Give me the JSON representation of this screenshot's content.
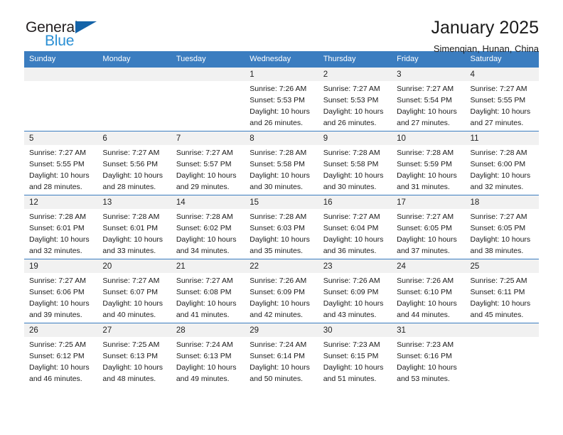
{
  "brand": {
    "word_top": "General",
    "word_bottom": "Blue",
    "triangle_color": "#1463a8",
    "blue_color": "#2a8fd4"
  },
  "header": {
    "title": "January 2025",
    "subtitle": "Simenqian, Hunan, China"
  },
  "colors": {
    "header_row": "#3b7dc0",
    "daynum_band": "#f1f1f1",
    "grid_line": "#3b7dc0"
  },
  "weekdays": [
    "Sunday",
    "Monday",
    "Tuesday",
    "Wednesday",
    "Thursday",
    "Friday",
    "Saturday"
  ],
  "labels": {
    "sunrise_prefix": "Sunrise: ",
    "sunset_prefix": "Sunset: ",
    "daylight_prefix": "Daylight: "
  },
  "weeks": [
    [
      {
        "day": "",
        "empty": true
      },
      {
        "day": "",
        "empty": true
      },
      {
        "day": "",
        "empty": true
      },
      {
        "day": "1",
        "sunrise": "Sunrise: 7:26 AM",
        "sunset": "Sunset: 5:53 PM",
        "daylight": "Daylight: 10 hours and 26 minutes."
      },
      {
        "day": "2",
        "sunrise": "Sunrise: 7:27 AM",
        "sunset": "Sunset: 5:53 PM",
        "daylight": "Daylight: 10 hours and 26 minutes."
      },
      {
        "day": "3",
        "sunrise": "Sunrise: 7:27 AM",
        "sunset": "Sunset: 5:54 PM",
        "daylight": "Daylight: 10 hours and 27 minutes."
      },
      {
        "day": "4",
        "sunrise": "Sunrise: 7:27 AM",
        "sunset": "Sunset: 5:55 PM",
        "daylight": "Daylight: 10 hours and 27 minutes."
      }
    ],
    [
      {
        "day": "5",
        "sunrise": "Sunrise: 7:27 AM",
        "sunset": "Sunset: 5:55 PM",
        "daylight": "Daylight: 10 hours and 28 minutes."
      },
      {
        "day": "6",
        "sunrise": "Sunrise: 7:27 AM",
        "sunset": "Sunset: 5:56 PM",
        "daylight": "Daylight: 10 hours and 28 minutes."
      },
      {
        "day": "7",
        "sunrise": "Sunrise: 7:27 AM",
        "sunset": "Sunset: 5:57 PM",
        "daylight": "Daylight: 10 hours and 29 minutes."
      },
      {
        "day": "8",
        "sunrise": "Sunrise: 7:28 AM",
        "sunset": "Sunset: 5:58 PM",
        "daylight": "Daylight: 10 hours and 30 minutes."
      },
      {
        "day": "9",
        "sunrise": "Sunrise: 7:28 AM",
        "sunset": "Sunset: 5:58 PM",
        "daylight": "Daylight: 10 hours and 30 minutes."
      },
      {
        "day": "10",
        "sunrise": "Sunrise: 7:28 AM",
        "sunset": "Sunset: 5:59 PM",
        "daylight": "Daylight: 10 hours and 31 minutes."
      },
      {
        "day": "11",
        "sunrise": "Sunrise: 7:28 AM",
        "sunset": "Sunset: 6:00 PM",
        "daylight": "Daylight: 10 hours and 32 minutes."
      }
    ],
    [
      {
        "day": "12",
        "sunrise": "Sunrise: 7:28 AM",
        "sunset": "Sunset: 6:01 PM",
        "daylight": "Daylight: 10 hours and 32 minutes."
      },
      {
        "day": "13",
        "sunrise": "Sunrise: 7:28 AM",
        "sunset": "Sunset: 6:01 PM",
        "daylight": "Daylight: 10 hours and 33 minutes."
      },
      {
        "day": "14",
        "sunrise": "Sunrise: 7:28 AM",
        "sunset": "Sunset: 6:02 PM",
        "daylight": "Daylight: 10 hours and 34 minutes."
      },
      {
        "day": "15",
        "sunrise": "Sunrise: 7:28 AM",
        "sunset": "Sunset: 6:03 PM",
        "daylight": "Daylight: 10 hours and 35 minutes."
      },
      {
        "day": "16",
        "sunrise": "Sunrise: 7:27 AM",
        "sunset": "Sunset: 6:04 PM",
        "daylight": "Daylight: 10 hours and 36 minutes."
      },
      {
        "day": "17",
        "sunrise": "Sunrise: 7:27 AM",
        "sunset": "Sunset: 6:05 PM",
        "daylight": "Daylight: 10 hours and 37 minutes."
      },
      {
        "day": "18",
        "sunrise": "Sunrise: 7:27 AM",
        "sunset": "Sunset: 6:05 PM",
        "daylight": "Daylight: 10 hours and 38 minutes."
      }
    ],
    [
      {
        "day": "19",
        "sunrise": "Sunrise: 7:27 AM",
        "sunset": "Sunset: 6:06 PM",
        "daylight": "Daylight: 10 hours and 39 minutes."
      },
      {
        "day": "20",
        "sunrise": "Sunrise: 7:27 AM",
        "sunset": "Sunset: 6:07 PM",
        "daylight": "Daylight: 10 hours and 40 minutes."
      },
      {
        "day": "21",
        "sunrise": "Sunrise: 7:27 AM",
        "sunset": "Sunset: 6:08 PM",
        "daylight": "Daylight: 10 hours and 41 minutes."
      },
      {
        "day": "22",
        "sunrise": "Sunrise: 7:26 AM",
        "sunset": "Sunset: 6:09 PM",
        "daylight": "Daylight: 10 hours and 42 minutes."
      },
      {
        "day": "23",
        "sunrise": "Sunrise: 7:26 AM",
        "sunset": "Sunset: 6:09 PM",
        "daylight": "Daylight: 10 hours and 43 minutes."
      },
      {
        "day": "24",
        "sunrise": "Sunrise: 7:26 AM",
        "sunset": "Sunset: 6:10 PM",
        "daylight": "Daylight: 10 hours and 44 minutes."
      },
      {
        "day": "25",
        "sunrise": "Sunrise: 7:25 AM",
        "sunset": "Sunset: 6:11 PM",
        "daylight": "Daylight: 10 hours and 45 minutes."
      }
    ],
    [
      {
        "day": "26",
        "sunrise": "Sunrise: 7:25 AM",
        "sunset": "Sunset: 6:12 PM",
        "daylight": "Daylight: 10 hours and 46 minutes."
      },
      {
        "day": "27",
        "sunrise": "Sunrise: 7:25 AM",
        "sunset": "Sunset: 6:13 PM",
        "daylight": "Daylight: 10 hours and 48 minutes."
      },
      {
        "day": "28",
        "sunrise": "Sunrise: 7:24 AM",
        "sunset": "Sunset: 6:13 PM",
        "daylight": "Daylight: 10 hours and 49 minutes."
      },
      {
        "day": "29",
        "sunrise": "Sunrise: 7:24 AM",
        "sunset": "Sunset: 6:14 PM",
        "daylight": "Daylight: 10 hours and 50 minutes."
      },
      {
        "day": "30",
        "sunrise": "Sunrise: 7:23 AM",
        "sunset": "Sunset: 6:15 PM",
        "daylight": "Daylight: 10 hours and 51 minutes."
      },
      {
        "day": "31",
        "sunrise": "Sunrise: 7:23 AM",
        "sunset": "Sunset: 6:16 PM",
        "daylight": "Daylight: 10 hours and 53 minutes."
      },
      {
        "day": "",
        "empty": true
      }
    ]
  ]
}
